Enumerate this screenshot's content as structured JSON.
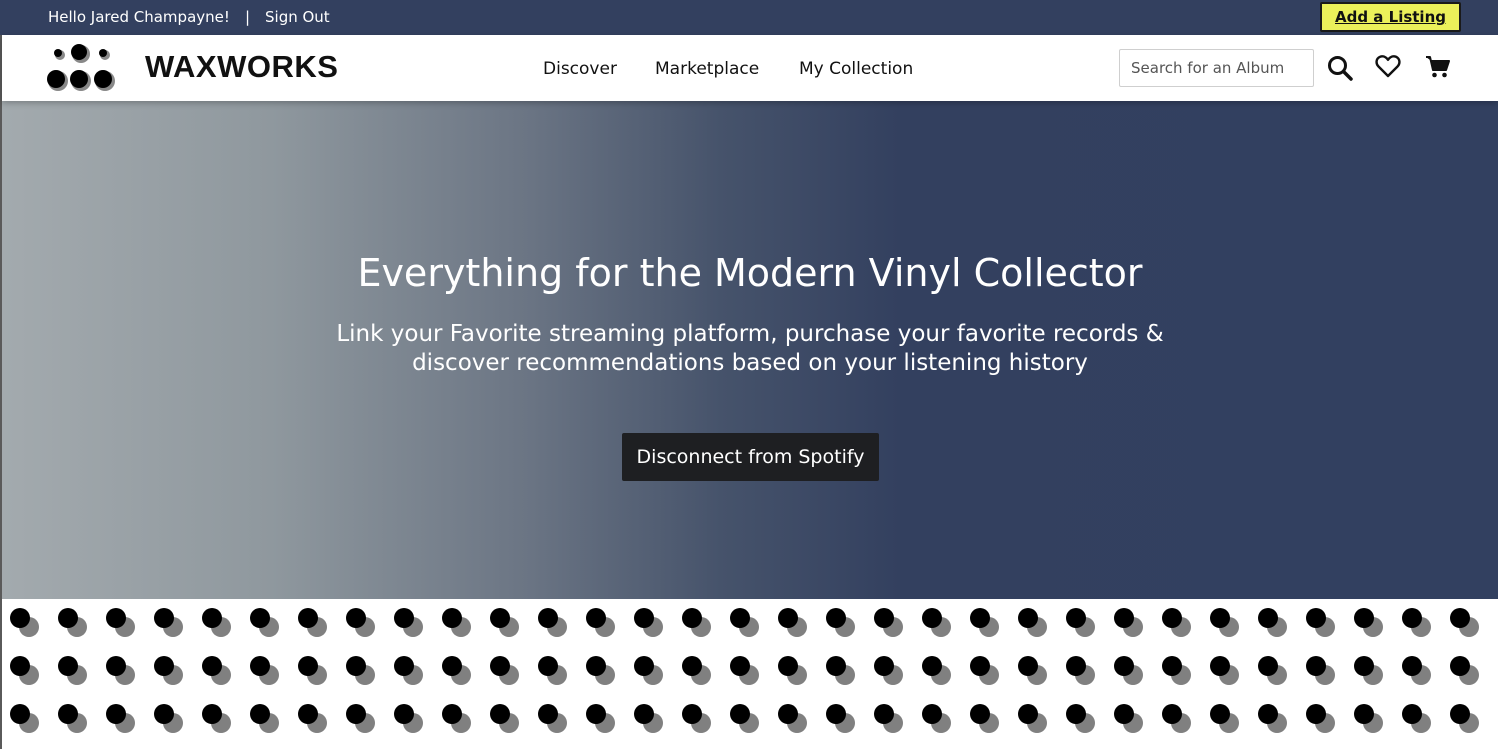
{
  "topbar": {
    "greeting": "Hello Jared Champayne!",
    "separator": "|",
    "sign_out": "Sign Out",
    "add_listing": "Add a Listing",
    "background_color": "#33405f",
    "accent_color": "#ebf05a"
  },
  "header": {
    "brand": "WAXWORKS",
    "logo_icon": "dots-logo-icon",
    "nav": {
      "discover": "Discover",
      "marketplace": "Marketplace",
      "my_collection": "My Collection"
    },
    "search": {
      "placeholder": "Search for an Album",
      "value": ""
    },
    "icons": {
      "search": "search-icon",
      "favorites": "heart-icon",
      "cart": "cart-icon"
    }
  },
  "hero": {
    "title": "Everything for the Modern Vinyl Collector",
    "subtitle": "Link your Favorite streaming platform, purchase your favorite records & discover recommendations based on your listening history",
    "button": "Disconnect from Spotify",
    "button_color": "#1e1f22"
  },
  "pattern": {
    "icon": "vinyl-dot-pattern",
    "front_color": "#000000",
    "back_color": "#808080"
  }
}
